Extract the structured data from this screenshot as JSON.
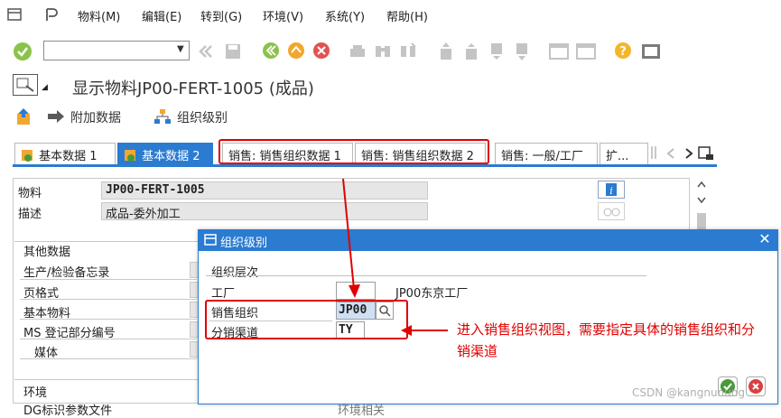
{
  "menubar": {
    "items": [
      "物料(M)",
      "编辑(E)",
      "转到(G)",
      "环境(V)",
      "系统(Y)",
      "帮助(H)"
    ]
  },
  "toolbar": {
    "command_field_value": ""
  },
  "title": {
    "text": "显示物料JP00-FERT-1005 (成品)"
  },
  "subtoolbar": {
    "additional_data": "附加数据",
    "org_levels": "组织级别"
  },
  "tabs": [
    {
      "label": "基本数据 1",
      "active": false
    },
    {
      "label": "基本数据 2",
      "active": true
    },
    {
      "label": "销售: 销售组织数据 1",
      "active": false
    },
    {
      "label": "销售: 销售组织数据 2",
      "active": false
    },
    {
      "label": "销售: 一般/工厂",
      "active": false
    },
    {
      "label": "扩...",
      "active": false
    }
  ],
  "form": {
    "material_label": "物料",
    "material_value": "JP00-FERT-1005",
    "description_label": "描述",
    "description_value": "成品-委外加工",
    "other_data_heading": "其他数据",
    "other_rows": [
      "生产/检验备忘录",
      "页格式",
      "基本物料",
      "MS 登记部分编号",
      "媒体"
    ],
    "environment_heading": "环境",
    "last_row_partial": "DG标识参数文件",
    "last_row_right_partial": "环境相关"
  },
  "dialog": {
    "title": "组织级别",
    "group_heading": "组织层次",
    "plant_label": "工厂",
    "plant_value": "",
    "plant_desc": "JP00东京工厂",
    "sales_org_label": "销售组织",
    "sales_org_value": "JP00",
    "dist_channel_label": "分销渠道",
    "dist_channel_value": "TY"
  },
  "annotation": {
    "text": "进入销售组织视图，需要指定具体的销售组织和分销渠道"
  },
  "watermark": {
    "text": "CSDN @kangnunung"
  },
  "colors": {
    "sap_blue": "#2b7bd1",
    "highlight_red": "#e00000"
  }
}
